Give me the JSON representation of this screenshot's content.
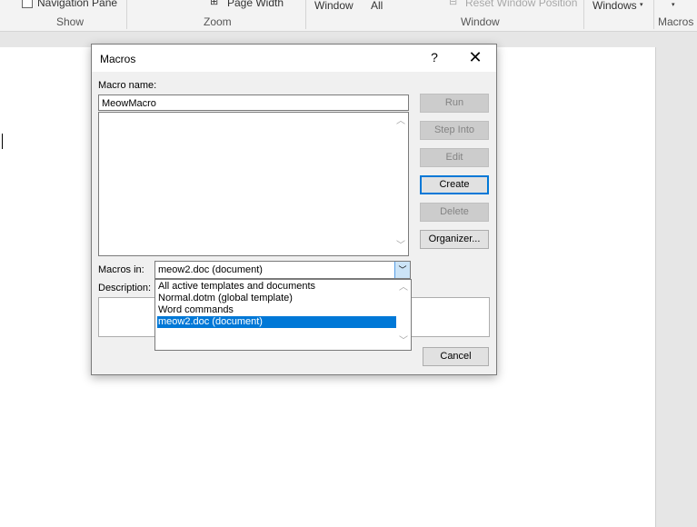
{
  "ribbon": {
    "navigation_pane": "Navigation Pane",
    "show_group": "Show",
    "page_width": "Page Width",
    "zoom_group": "Zoom",
    "window_item": "Window",
    "all_item": "All",
    "reset_window_position": "Reset Window Position",
    "windows_item": "Windows",
    "window_group": "Window",
    "macros_group": "Macros"
  },
  "dialog": {
    "title": "Macros",
    "help": "?",
    "close": "✕",
    "macro_name_label": "Macro name:",
    "macro_name_value": "MeowMacro",
    "macros_in_label": "Macros in:",
    "macros_in_value": "meow2.doc (document)",
    "description_label": "Description:",
    "buttons": {
      "run": "Run",
      "step_into": "Step Into",
      "edit": "Edit",
      "create": "Create",
      "delete": "Delete",
      "organizer": "Organizer...",
      "cancel": "Cancel"
    },
    "dropdown_options": [
      "All active templates and documents",
      "Normal.dotm (global template)",
      "Word commands",
      "meow2.doc (document)"
    ]
  },
  "colors": {
    "accent": "#0078d7",
    "dialog_bg": "#f0f0f0",
    "disabled_button": "#cccccc"
  }
}
